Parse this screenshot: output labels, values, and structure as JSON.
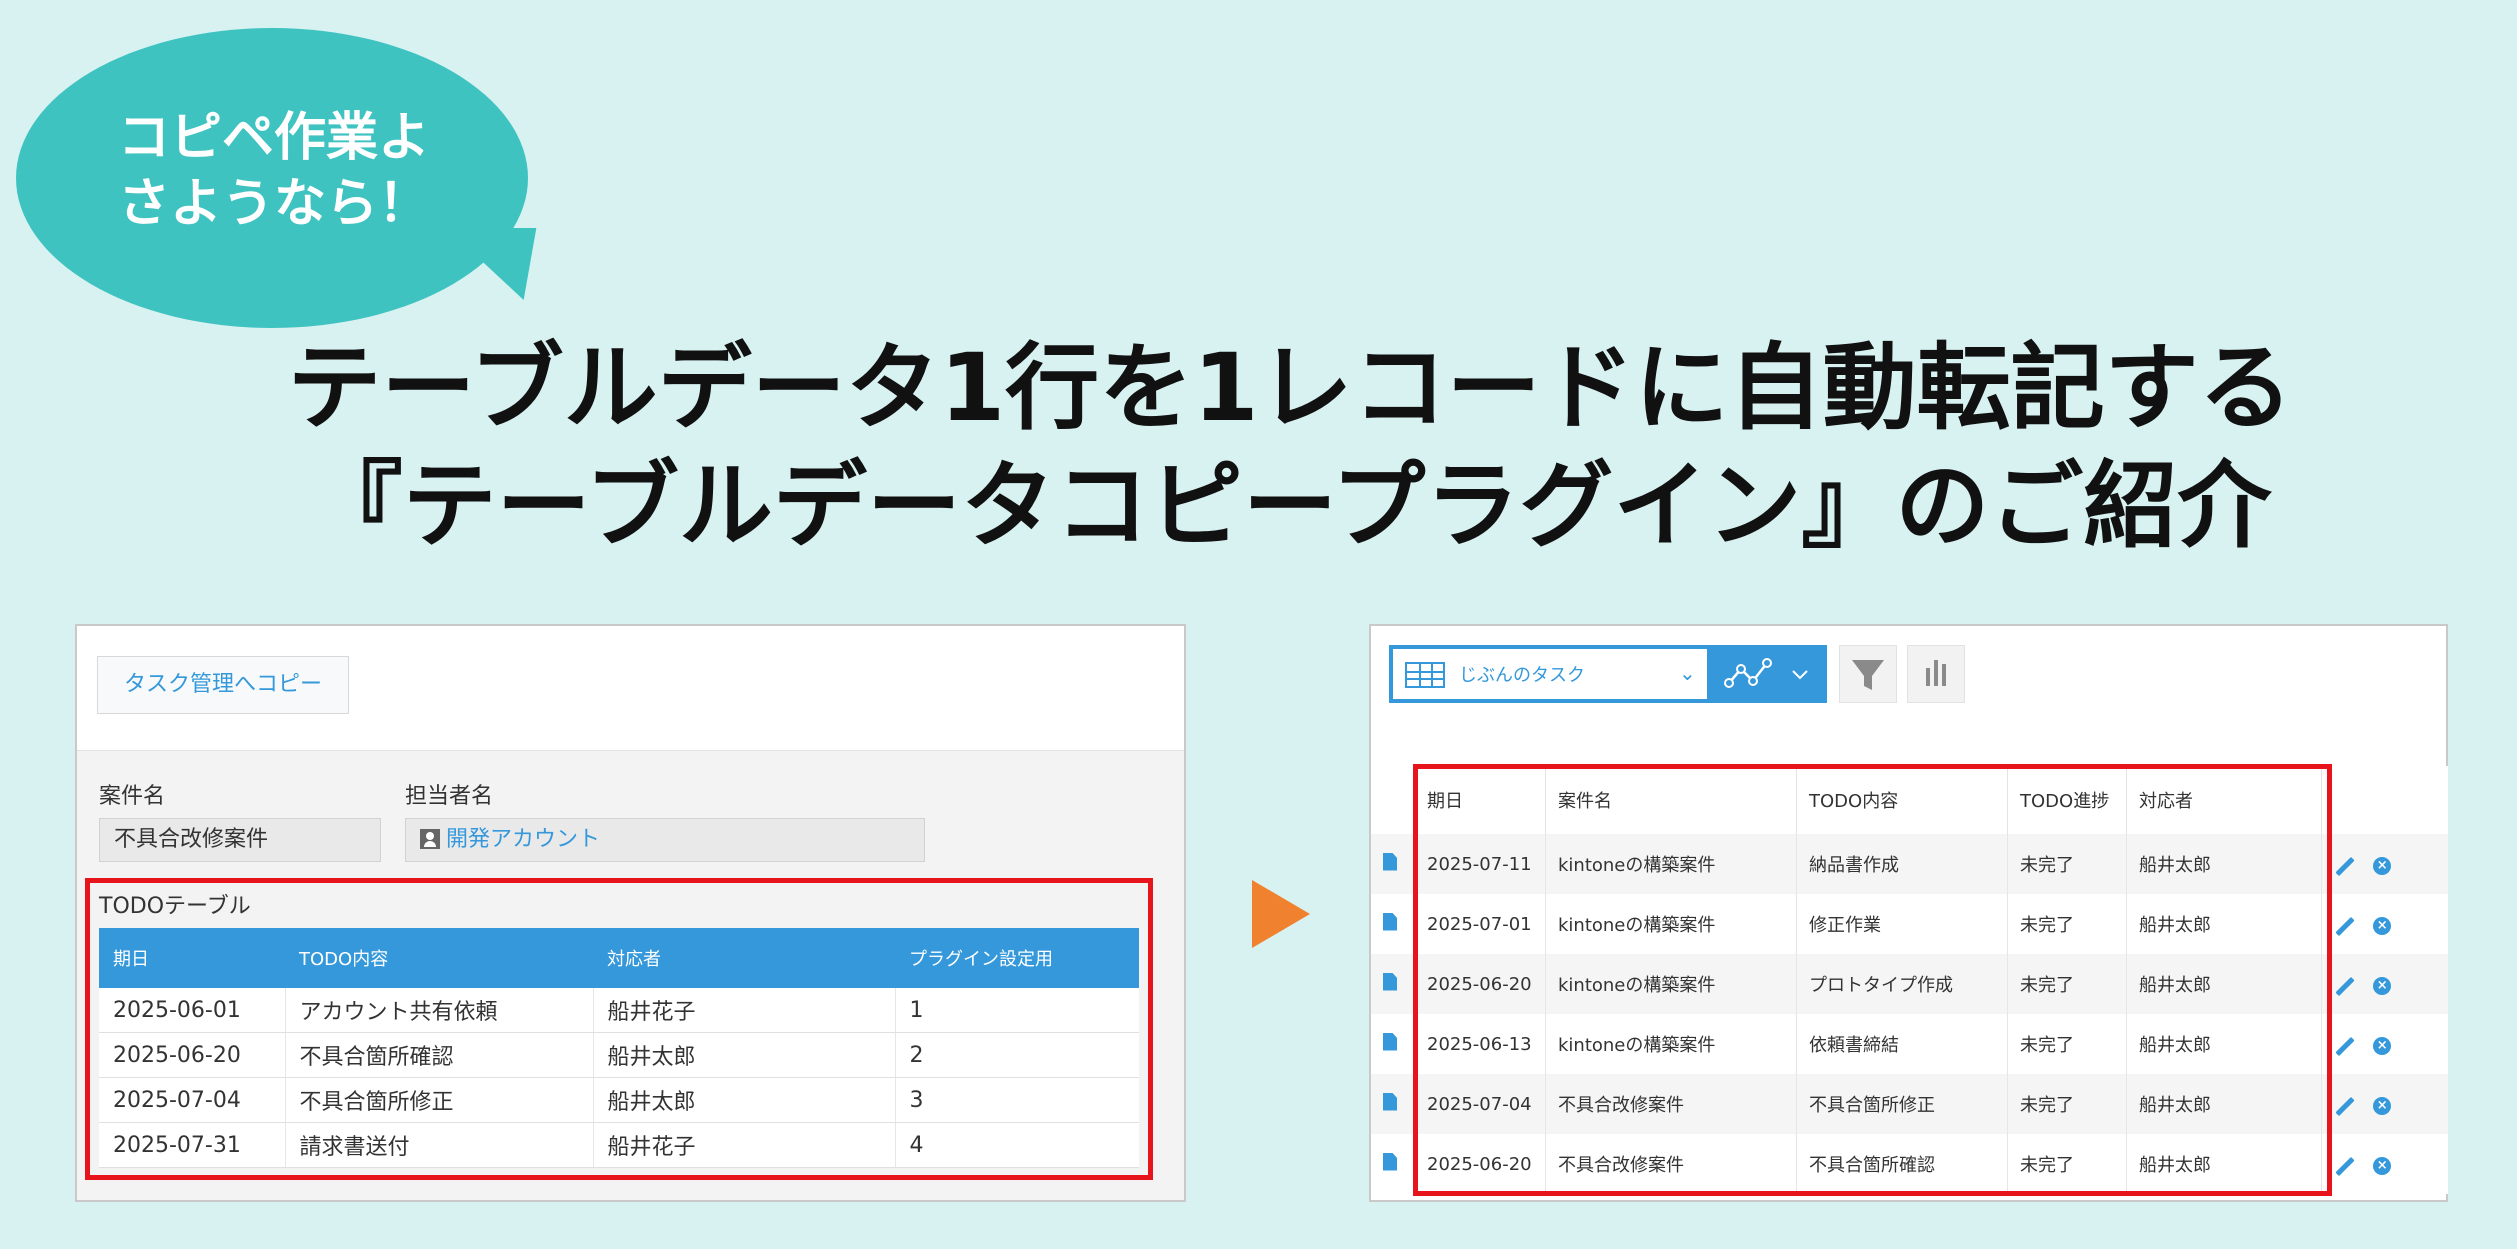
{
  "bubble": {
    "line1": "コピペ作業よ",
    "line2": "さようなら！"
  },
  "headline": {
    "line1": "テーブルデータ1行を1レコードに自動転記する",
    "line2": "『テーブルデータコピープラグイン』のご紹介"
  },
  "left_panel": {
    "copy_button": "タスク管理へコピー",
    "case_label": "案件名",
    "case_value": "不具合改修案件",
    "owner_label": "担当者名",
    "owner_value": "開発アカウント",
    "table_title": "TODOテーブル",
    "columns": [
      "期日",
      "TODO内容",
      "対応者",
      "プラグイン設定用"
    ],
    "rows": [
      [
        "2025-06-01",
        "アカウント共有依頼",
        "船井花子",
        "1"
      ],
      [
        "2025-06-20",
        "不具合箇所確認",
        "船井太郎",
        "2"
      ],
      [
        "2025-07-04",
        "不具合箇所修正",
        "船井太郎",
        "3"
      ],
      [
        "2025-07-31",
        "請求書送付",
        "船井花子",
        "4"
      ]
    ]
  },
  "right_panel": {
    "view_name": "じぶんのタスク",
    "columns": [
      "期日",
      "案件名",
      "TODO内容",
      "TODO進捗",
      "対応者"
    ],
    "rows": [
      [
        "2025-07-11",
        "kintoneの構築案件",
        "納品書作成",
        "未完了",
        "船井太郎"
      ],
      [
        "2025-07-01",
        "kintoneの構築案件",
        "修正作業",
        "未完了",
        "船井太郎"
      ],
      [
        "2025-06-20",
        "kintoneの構築案件",
        "プロトタイプ作成",
        "未完了",
        "船井太郎"
      ],
      [
        "2025-06-13",
        "kintoneの構築案件",
        "依頼書締結",
        "未完了",
        "船井太郎"
      ],
      [
        "2025-07-04",
        "不具合改修案件",
        "不具合箇所修正",
        "未完了",
        "船井太郎"
      ],
      [
        "2025-06-20",
        "不具合改修案件",
        "不具合箇所確認",
        "未完了",
        "船井太郎"
      ]
    ]
  },
  "icons": {
    "record": "document-icon",
    "edit": "pencil-icon",
    "delete": "delete-circle-icon",
    "filter": "funnel-icon",
    "graph": "graph-icon",
    "bar": "bar-chart-icon"
  },
  "colors": {
    "background": "#d8f2f2",
    "bubble": "#3fc3c0",
    "accent": "#3498db",
    "highlight": "#e8141b",
    "arrow": "#f0812e"
  }
}
